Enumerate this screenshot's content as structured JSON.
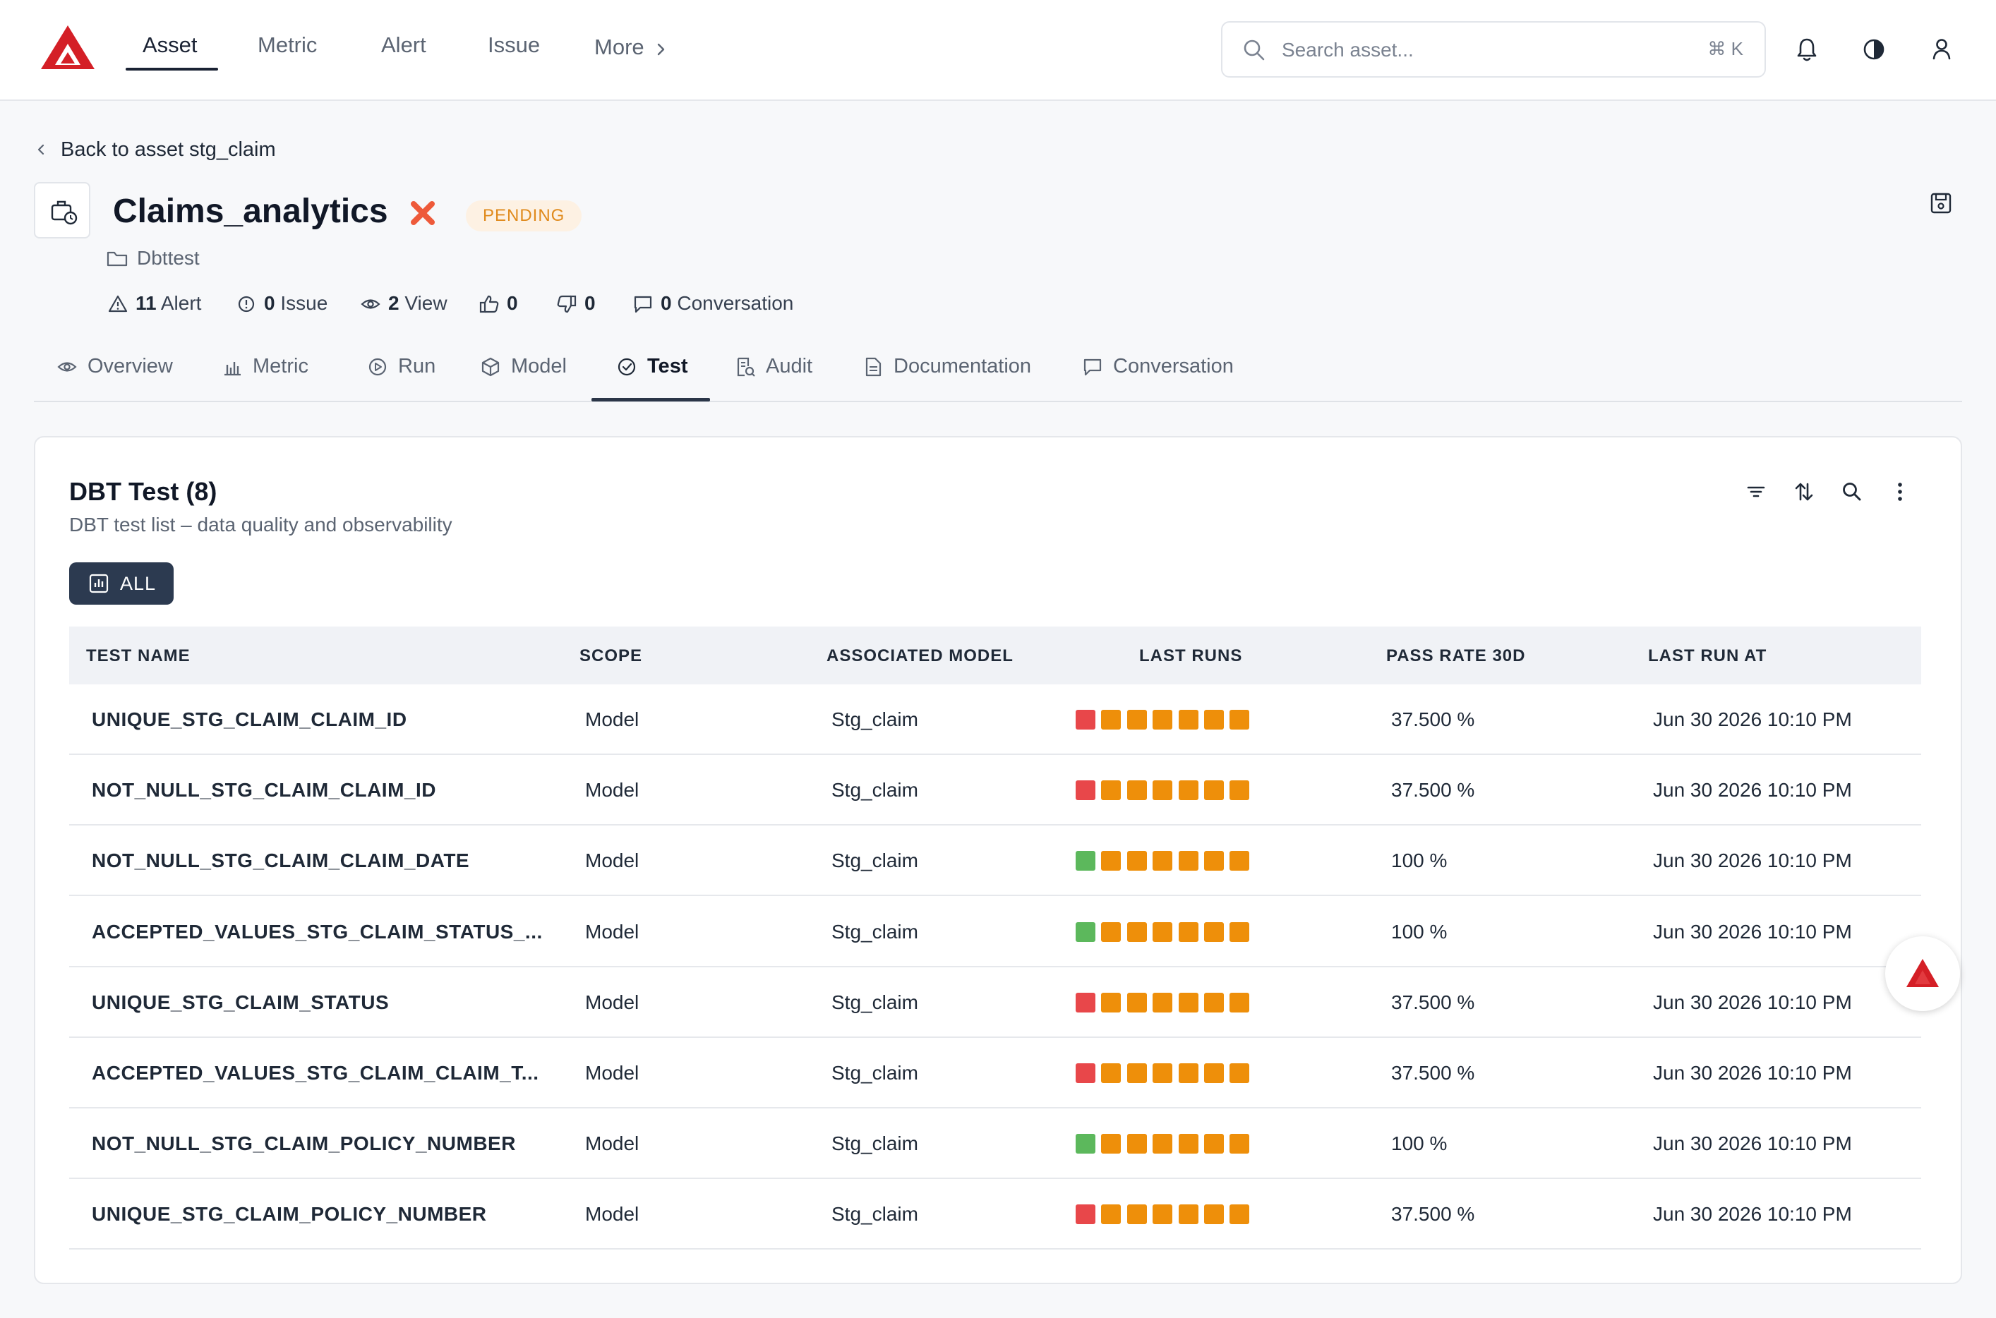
{
  "nav": {
    "items": [
      "Asset",
      "Metric",
      "Alert",
      "Issue",
      "More"
    ],
    "active": "Asset"
  },
  "search": {
    "placeholder": "Search asset...",
    "shortcut": "⌘ K"
  },
  "header": {
    "back_label": "Back to asset stg_claim",
    "title": "Claims_analytics",
    "status": "PENDING",
    "folder": "Dbttest",
    "stats": {
      "alerts": {
        "num": "11",
        "label": "Alert"
      },
      "issues": {
        "num": "0",
        "label": "Issue"
      },
      "views": {
        "num": "2",
        "label": "View"
      },
      "likes": {
        "num": "0"
      },
      "dislikes": {
        "num": "0"
      },
      "conversations": {
        "num": "0",
        "label": "Conversation"
      }
    }
  },
  "tabs": [
    "Overview",
    "Metric",
    "Run",
    "Model",
    "Test",
    "Audit",
    "Documentation",
    "Conversation"
  ],
  "active_tab": "Test",
  "card": {
    "title": "DBT Test (8)",
    "subtitle": "DBT test list – data quality and observability",
    "filter_chip": "ALL"
  },
  "table": {
    "columns": [
      "TEST NAME",
      "SCOPE",
      "ASSOCIATED MODEL",
      "LAST RUNS",
      "PASS RATE 30D",
      "LAST RUN AT"
    ],
    "rows": [
      {
        "name": "UNIQUE_STG_CLAIM_CLAIM_ID",
        "scope": "Model",
        "model": "Stg_claim",
        "runs": [
          "fail",
          "warn",
          "warn",
          "warn",
          "warn",
          "warn",
          "warn"
        ],
        "pass_rate": "37.500 %",
        "last_run": "Jun 30 2026 10:10 PM"
      },
      {
        "name": "NOT_NULL_STG_CLAIM_CLAIM_ID",
        "scope": "Model",
        "model": "Stg_claim",
        "runs": [
          "fail",
          "warn",
          "warn",
          "warn",
          "warn",
          "warn",
          "warn"
        ],
        "pass_rate": "37.500 %",
        "last_run": "Jun 30 2026 10:10 PM"
      },
      {
        "name": "NOT_NULL_STG_CLAIM_CLAIM_DATE",
        "scope": "Model",
        "model": "Stg_claim",
        "runs": [
          "pass",
          "warn",
          "warn",
          "warn",
          "warn",
          "warn",
          "warn"
        ],
        "pass_rate": "100 %",
        "last_run": "Jun 30 2026 10:10 PM"
      },
      {
        "name": "ACCEPTED_VALUES_STG_CLAIM_STATUS_...",
        "scope": "Model",
        "model": "Stg_claim",
        "runs": [
          "pass",
          "warn",
          "warn",
          "warn",
          "warn",
          "warn",
          "warn"
        ],
        "pass_rate": "100 %",
        "last_run": "Jun 30 2026 10:10 PM"
      },
      {
        "name": "UNIQUE_STG_CLAIM_STATUS",
        "scope": "Model",
        "model": "Stg_claim",
        "runs": [
          "fail",
          "warn",
          "warn",
          "warn",
          "warn",
          "warn",
          "warn"
        ],
        "pass_rate": "37.500 %",
        "last_run": "Jun 30 2026 10:10 PM"
      },
      {
        "name": "ACCEPTED_VALUES_STG_CLAIM_CLAIM_T...",
        "scope": "Model",
        "model": "Stg_claim",
        "runs": [
          "fail",
          "warn",
          "warn",
          "warn",
          "warn",
          "warn",
          "warn"
        ],
        "pass_rate": "37.500 %",
        "last_run": "Jun 30 2026 10:10 PM"
      },
      {
        "name": "NOT_NULL_STG_CLAIM_POLICY_NUMBER",
        "scope": "Model",
        "model": "Stg_claim",
        "runs": [
          "pass",
          "warn",
          "warn",
          "warn",
          "warn",
          "warn",
          "warn"
        ],
        "pass_rate": "100 %",
        "last_run": "Jun 30 2026 10:10 PM"
      },
      {
        "name": "UNIQUE_STG_CLAIM_POLICY_NUMBER",
        "scope": "Model",
        "model": "Stg_claim",
        "runs": [
          "fail",
          "warn",
          "warn",
          "warn",
          "warn",
          "warn",
          "warn"
        ],
        "pass_rate": "37.500 %",
        "last_run": "Jun 30 2026 10:10 PM"
      }
    ]
  },
  "colors": {
    "brand_red": "#d41f26",
    "run_pass": "#5cb85c",
    "run_fail": "#e8474a",
    "run_warn": "#ee8f0a",
    "pending": "#e08a1c",
    "chip_bg": "#2c3a50"
  },
  "icons": {
    "logo": "brand-triangle-logo",
    "search": "search-icon",
    "notifications": "bell-icon",
    "theme": "contrast-icon",
    "account": "user-icon",
    "asset": "briefcase-clock-icon",
    "status_mark": "x-mark-icon",
    "save": "save-icon",
    "folder": "folder-icon",
    "filter": "filter-icon",
    "sort": "sort-icon",
    "card_search": "search-icon",
    "more": "more-vertical-icon",
    "chip": "bar-chart-icon",
    "assistant": "brand-triangle-logo"
  }
}
